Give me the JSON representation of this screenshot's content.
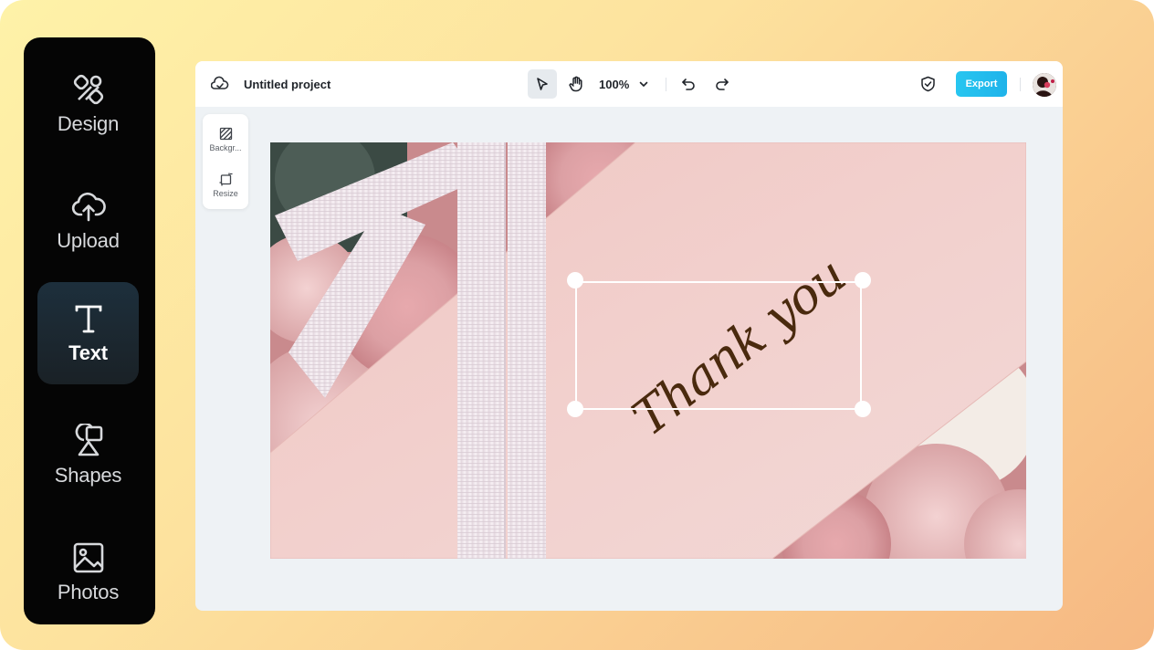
{
  "sidebar": {
    "items": [
      {
        "label": "Design",
        "icon": "design-icon"
      },
      {
        "label": "Upload",
        "icon": "upload-icon"
      },
      {
        "label": "Text",
        "icon": "text-icon",
        "active": true
      },
      {
        "label": "Shapes",
        "icon": "shapes-icon"
      },
      {
        "label": "Photos",
        "icon": "photos-icon"
      }
    ]
  },
  "toolbar": {
    "project_title": "Untitled project",
    "zoom": "100%",
    "export_label": "Export",
    "icons": [
      "cloud-icon",
      "select-pointer-icon",
      "hand-pan-icon",
      "chevron-down-icon",
      "undo-icon",
      "redo-icon",
      "shield-check-icon"
    ]
  },
  "mini_panel": {
    "items": [
      {
        "label": "Backgr...",
        "icon": "background-icon"
      },
      {
        "label": "Resize",
        "icon": "resize-icon"
      }
    ]
  },
  "canvas": {
    "text": "Thank you",
    "text_color": "#4a2a0e"
  },
  "colors": {
    "accent": "#1fb3ea",
    "sidebar_bg": "#050505",
    "active_item": "#1d2f3c"
  }
}
